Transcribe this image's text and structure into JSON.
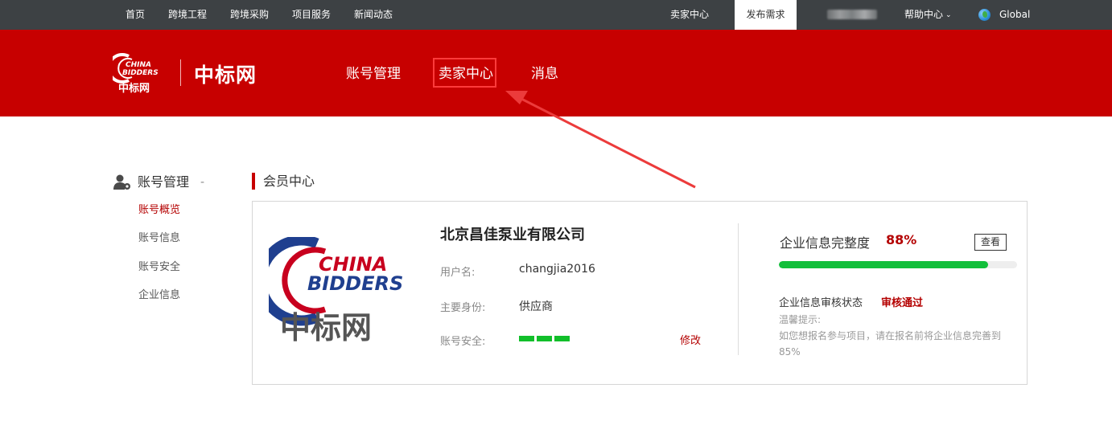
{
  "topbar": {
    "nav": [
      "首页",
      "跨境工程",
      "跨境采购",
      "项目服务",
      "新闻动态"
    ],
    "seller_center": "卖家中心",
    "publish": "发布需求",
    "help": "帮助中心",
    "region": "Global"
  },
  "header": {
    "site_name": "中标网",
    "logo_text": "CHINA BIDDERS 中标网",
    "nav": [
      "账号管理",
      "卖家中心",
      "消息"
    ],
    "accent": "#c70000"
  },
  "sidebar": {
    "title": "账号管理",
    "collapse": "-",
    "items": [
      "账号概览",
      "账号信息",
      "账号安全",
      "企业信息"
    ]
  },
  "section": {
    "title": "会员中心"
  },
  "profile": {
    "company": "北京昌佳泵业有限公司",
    "username_label": "用户名:",
    "username": "changjia2016",
    "role_label": "主要身份:",
    "role": "供应商",
    "security_label": "账号安全:",
    "security_level": 3,
    "modify": "修改"
  },
  "completeness": {
    "label": "企业信息完整度",
    "percent_text": "88%",
    "percent": 88,
    "view": "查看",
    "audit_label": "企业信息审核状态",
    "audit_status": "审核通过",
    "tip_title": "温馨提示:",
    "tip_text": "如您想报名参与项目，请在报名前将企业信息完善到85%"
  }
}
